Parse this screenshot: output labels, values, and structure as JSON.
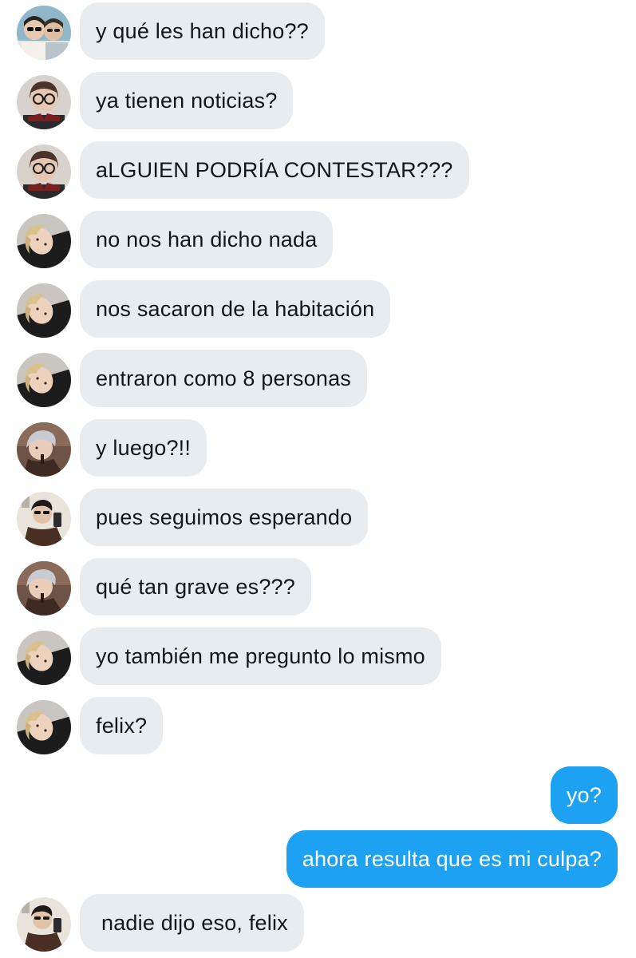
{
  "messages": [
    {
      "sender": "other",
      "avatar": "avatar-duo-glasses-icon",
      "text": "y qué les han dicho??"
    },
    {
      "sender": "other",
      "avatar": "avatar-glasses-icon",
      "text": "ya tienen noticias?"
    },
    {
      "sender": "other",
      "avatar": "avatar-glasses-icon",
      "text": "aLGUIEN PODRÍA CONTESTAR???"
    },
    {
      "sender": "other",
      "avatar": "avatar-blonde-icon",
      "text": "no nos han dicho nada"
    },
    {
      "sender": "other",
      "avatar": "avatar-blonde-icon",
      "text": "nos sacaron de la habitación"
    },
    {
      "sender": "other",
      "avatar": "avatar-blonde-icon",
      "text": "entraron como 8 personas"
    },
    {
      "sender": "other",
      "avatar": "avatar-silver-hair-icon",
      "text": "y luego?!!"
    },
    {
      "sender": "other",
      "avatar": "avatar-mirror-selfie-icon",
      "text": "pues seguimos esperando"
    },
    {
      "sender": "other",
      "avatar": "avatar-silver-hair-icon",
      "text": "qué tan grave es???"
    },
    {
      "sender": "other",
      "avatar": "avatar-blonde-icon",
      "text": "yo también me pregunto lo mismo"
    },
    {
      "sender": "other",
      "avatar": "avatar-blonde-icon",
      "text": "felix?"
    },
    {
      "sender": "me",
      "text": "yo?"
    },
    {
      "sender": "me",
      "text": "ahora resulta que es mi culpa?"
    },
    {
      "sender": "other",
      "avatar": "avatar-mirror-selfie-icon",
      "text": "nadie dijo eso, felix"
    }
  ],
  "colors": {
    "incoming_bubble": "#e6ecf0",
    "outgoing_bubble": "#1da1f2",
    "incoming_text": "#14171a",
    "outgoing_text": "#ffffff"
  }
}
